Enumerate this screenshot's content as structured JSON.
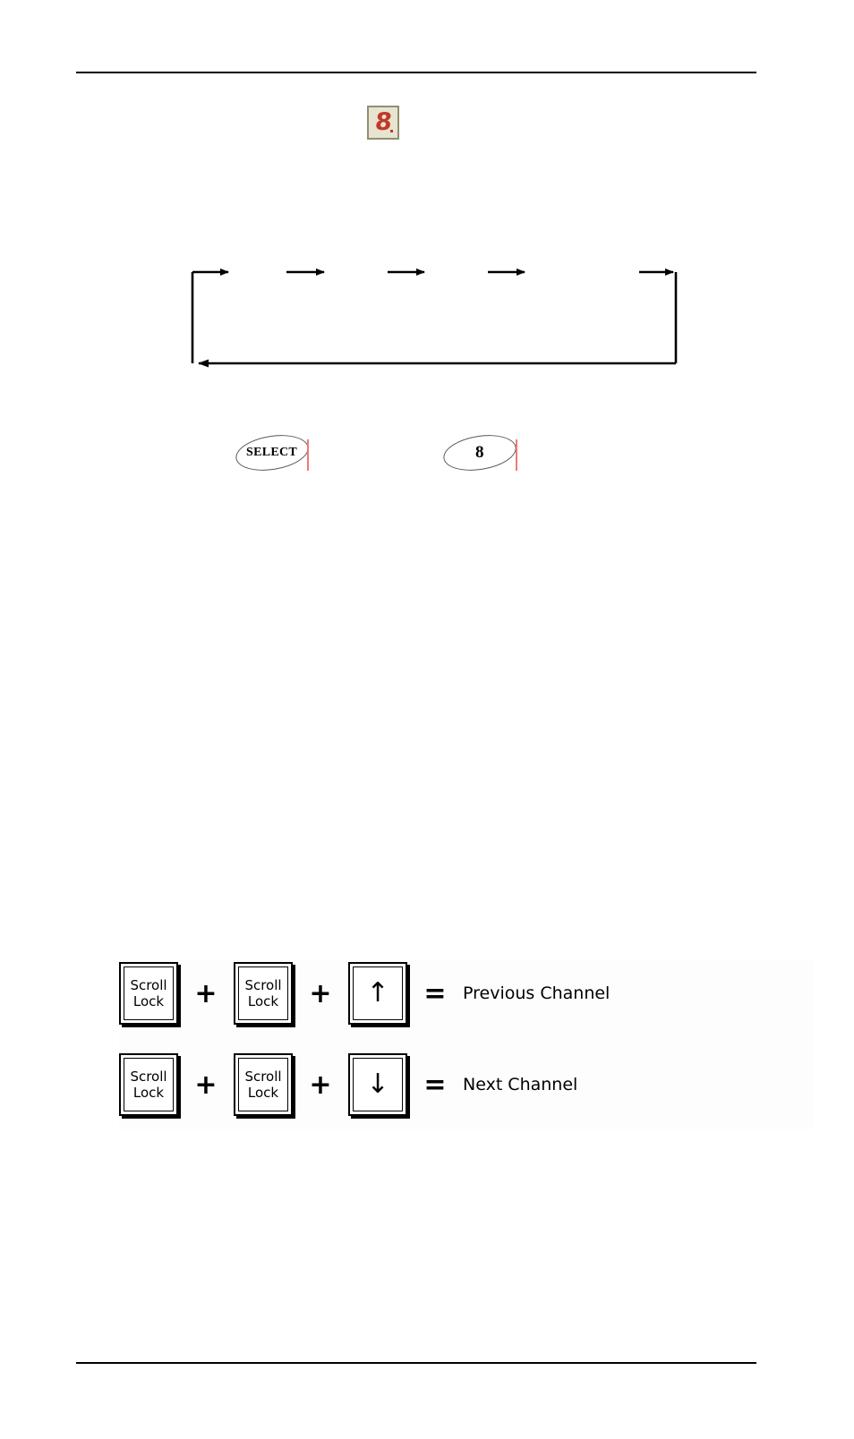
{
  "page": {
    "header_text": "",
    "footer_text": ""
  },
  "display": {
    "name": "seven-segment-display",
    "digit": "8",
    "has_decimal_point": true,
    "body_color": "#e8e4cf",
    "bezel_color": "#8f8f72",
    "segment_color": "#c0392b"
  },
  "cycle_diagram": {
    "type": "cycle-flow",
    "direction": "left-to-right-with-return",
    "top_arrow_count": 5,
    "return_arrow_label": "",
    "stroke_color": "#000000",
    "nodes": [
      "",
      "",
      "",
      "",
      "",
      ""
    ],
    "arrow_labels": [
      "",
      "",
      "",
      "",
      ""
    ]
  },
  "callouts": [
    {
      "name": "callout-select",
      "label": "SELECT",
      "caret_color": "#f07a72"
    },
    {
      "name": "callout-eight",
      "label": "8",
      "caret_color": "#f07a72"
    }
  ],
  "shortcuts": {
    "panel_background": "#fdfdfd",
    "rows": [
      {
        "keys": [
          {
            "type": "text",
            "line1": "Scroll",
            "line2": "Lock"
          },
          {
            "type": "text",
            "line1": "Scroll",
            "line2": "Lock"
          },
          {
            "type": "arrow",
            "glyph": "↑",
            "icon": "arrow-up-icon"
          }
        ],
        "operators": [
          "+",
          "+",
          "="
        ],
        "result": "Previous Channel"
      },
      {
        "keys": [
          {
            "type": "text",
            "line1": "Scroll",
            "line2": "Lock"
          },
          {
            "type": "text",
            "line1": "Scroll",
            "line2": "Lock"
          },
          {
            "type": "arrow",
            "glyph": "↓",
            "icon": "arrow-down-icon"
          }
        ],
        "operators": [
          "+",
          "+",
          "="
        ],
        "result": "Next Channel"
      }
    ]
  }
}
